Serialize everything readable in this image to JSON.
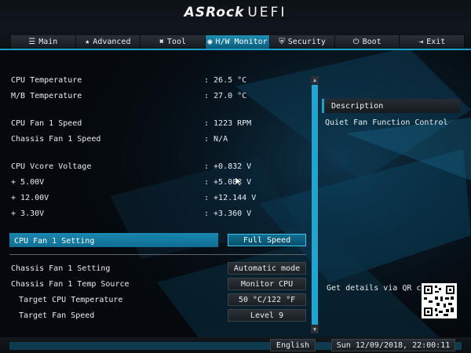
{
  "brand": {
    "name": "ASRock",
    "suffix": "UEFI"
  },
  "tabs": [
    {
      "label": "Main",
      "icon": "list-icon",
      "glyph": "☰"
    },
    {
      "label": "Advanced",
      "icon": "star-icon",
      "glyph": "★"
    },
    {
      "label": "Tool",
      "icon": "wrench-icon",
      "glyph": "✖"
    },
    {
      "label": "H/W Monitor",
      "icon": "monitor-gauge-icon",
      "glyph": "◉",
      "active": true
    },
    {
      "label": "Security",
      "icon": "shield-icon",
      "glyph": "⛨"
    },
    {
      "label": "Boot",
      "icon": "power-icon",
      "glyph": "⏻"
    },
    {
      "label": "Exit",
      "icon": "exit-icon",
      "glyph": "⇥"
    }
  ],
  "readings": [
    {
      "label": "CPU Temperature",
      "value": ": 26.5 °C"
    },
    {
      "label": "M/B Temperature",
      "value": ": 27.0 °C"
    },
    {
      "label": "CPU Fan 1 Speed",
      "value": ": 1223 RPM"
    },
    {
      "label": "Chassis Fan 1 Speed",
      "value": ": N/A"
    },
    {
      "label": "CPU Vcore Voltage",
      "value": ": +0.832 V"
    },
    {
      "label": "+ 5.00V",
      "value": ": +5.088 V"
    },
    {
      "label": "+ 12.00V",
      "value": ": +12.144 V"
    },
    {
      "label": "+ 3.30V",
      "value": ": +3.360 V"
    }
  ],
  "settings": {
    "cpu_fan": {
      "label": "CPU Fan 1 Setting",
      "value": "Full Speed"
    },
    "chassis_fan": {
      "label": "Chassis Fan 1 Setting",
      "value": "Automatic mode"
    },
    "chassis_temp_source": {
      "label": "Chassis Fan 1 Temp Source",
      "value": "Monitor CPU"
    },
    "target_cpu_temp": {
      "label": "Target CPU Temperature",
      "value": "50 °C/122 °F"
    },
    "target_fan_speed": {
      "label": "Target Fan Speed",
      "value": "Level 9"
    }
  },
  "description": {
    "title": "Description",
    "text": "Quiet Fan Function Control",
    "qr_label": "Get details via QR code"
  },
  "footer": {
    "language": "English",
    "datetime": "Sun 12/09/2018, 22:00:11"
  },
  "colors": {
    "accent": "#1aa2cf",
    "highlight": "#1a86b0",
    "background": "#05090d"
  }
}
